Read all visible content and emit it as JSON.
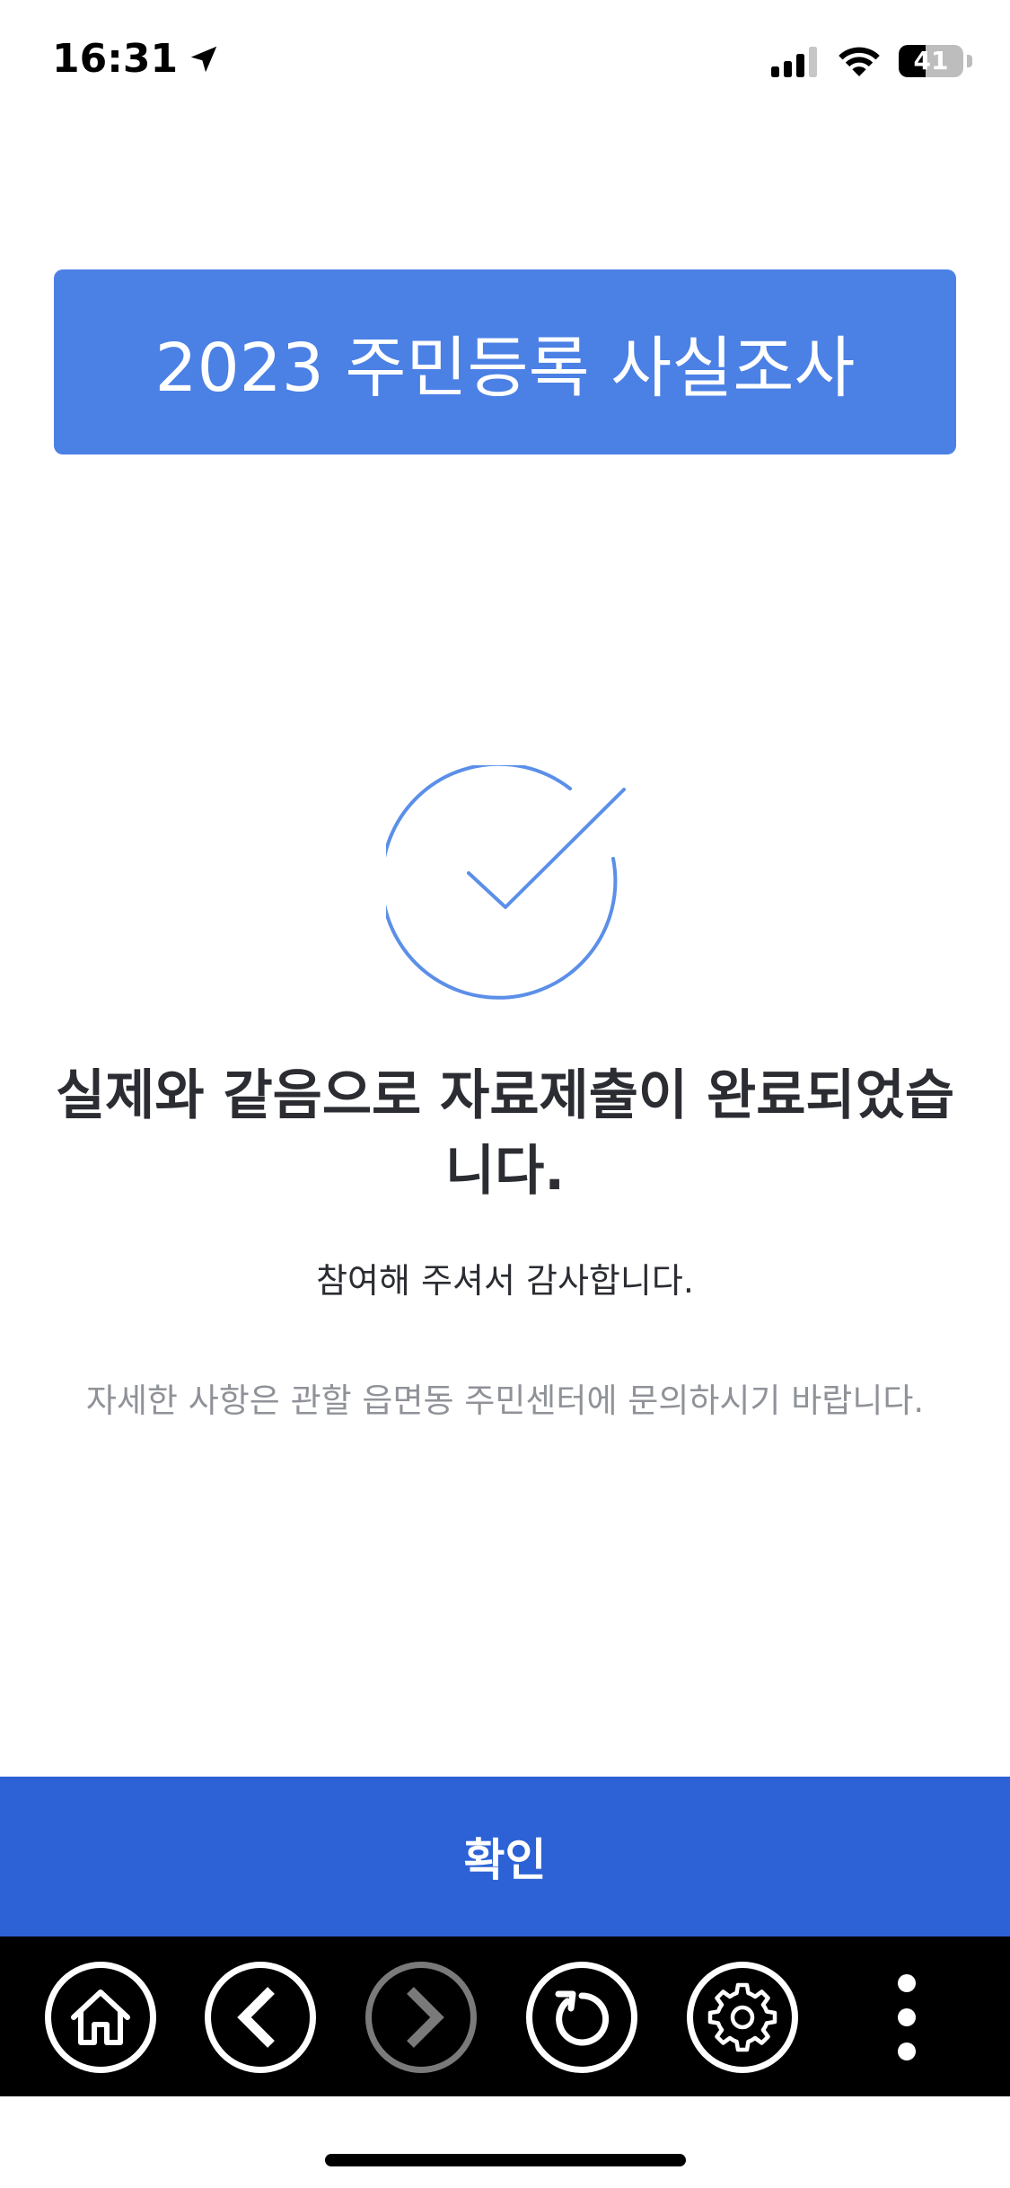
{
  "status_bar": {
    "time": "16:31",
    "battery_level": "41",
    "battery_fraction": 0.41,
    "location_icon": "location-arrow-icon",
    "signal_icon": "cellular-signal-icon",
    "wifi_icon": "wifi-icon"
  },
  "header": {
    "title": "2023 주민등록 사실조사",
    "color": "#4b80e5"
  },
  "result": {
    "icon": "check-circle-icon",
    "title": "실제와 같음으로 자료제출이 완료되었습니다.",
    "thanks": "참여해 주셔서 감사합니다.",
    "info": "자세한 사항은 관할 읍면동 주민센터에 문의하시기 바랍니다.",
    "accent_color": "#5b8fe8"
  },
  "confirm_button": {
    "label": "확인",
    "color": "#2c62d6"
  },
  "toolbar": {
    "buttons": [
      {
        "icon": "home-icon",
        "enabled": true
      },
      {
        "icon": "back-arrow-icon",
        "enabled": true
      },
      {
        "icon": "forward-arrow-icon",
        "enabled": false
      },
      {
        "icon": "refresh-icon",
        "enabled": true
      },
      {
        "icon": "gear-icon",
        "enabled": true
      },
      {
        "icon": "more-vertical-icon",
        "enabled": true
      }
    ]
  }
}
